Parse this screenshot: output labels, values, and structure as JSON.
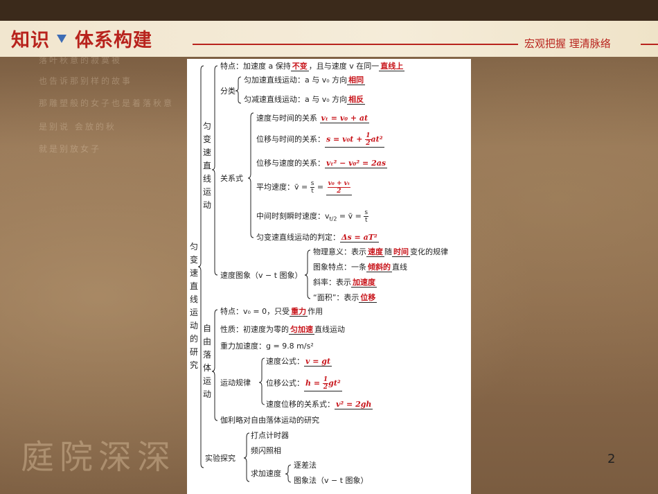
{
  "header": {
    "title_left": "知识",
    "title_right": "体系构建",
    "subtitle": "宏观把握  理清脉络"
  },
  "page_number": "2",
  "background_poem": [
    "落叶秋意的寂寞被",
    "也告诉那别样的故事",
    "那雕塑般的女子也是着落秋意",
    "是别说 会放的秋",
    "就是别放女子"
  ],
  "background_calligraphy": "庭院深深",
  "diagram": {
    "root": "匀变速直线运动的研究",
    "uam": {
      "label": "匀变速直线运动",
      "features": {
        "pre": "特点：加速度 a 保持",
        "ans1": "不变",
        "mid": "，且与速度 v 在同一",
        "ans2": "直线上"
      },
      "classification": {
        "label": "分类",
        "accel": {
          "pre": "匀加速直线运动：a 与 v₀ 方向",
          "ans": "相同"
        },
        "decel": {
          "pre": "匀减速直线运动：a 与 v₀ 方向",
          "ans": "相反"
        }
      },
      "relations": {
        "label": "关系式",
        "vt": {
          "pre": "速度与时间的关系",
          "ans": "vₜ = v₀ + at"
        },
        "xt": {
          "pre": "位移与时间的关系：",
          "ans_a": "s = v₀t + ",
          "ans_n": "1",
          "ans_d": "2",
          "ans_b": "at²"
        },
        "xv": {
          "pre": "位移与速度的关系：",
          "ans": "vₜ² − v₀² = 2as"
        },
        "avg": {
          "pre": "平均速度：v̄ = ",
          "s": "s",
          "t": "t",
          "eq": " = ",
          "ans_n": "v₀ + vₜ",
          "ans_d": "2"
        },
        "mid": {
          "pre": "中间时刻瞬时速度：v",
          "sub": "t/2",
          "eq": " = v̄ = ",
          "s": "s",
          "t": "t"
        },
        "judge": {
          "pre": "匀变速直线运动的判定：",
          "ans": "Δs = aT²"
        }
      },
      "vt_graph": {
        "label": "速度图象（v − t 图象）",
        "meaning": {
          "pre": "物理意义：表示",
          "ans1": "速度",
          "mid": "随",
          "ans2": "时间",
          "post": "变化的规律"
        },
        "feature": {
          "pre": "图象特点：一条",
          "ans": "倾斜的",
          "post": "直线"
        },
        "slope": {
          "pre": "斜率：表示",
          "ans": "加速度"
        },
        "area": {
          "pre": "“面积”：表示",
          "ans": "位移"
        }
      }
    },
    "freefall": {
      "label": "自由落体运动",
      "feature": {
        "pre": "特点：v₀ = 0，只受",
        "ans": "重力",
        "post": "作用"
      },
      "nature": {
        "pre": "性质：初速度为零的",
        "ans": "匀加速",
        "post": "直线运动"
      },
      "g": "重力加速度：g = 9.8 m/s²",
      "laws": {
        "label": "运动规律",
        "v": {
          "pre": "速度公式：",
          "ans": "v = gt"
        },
        "h": {
          "pre": "位移公式：",
          "ans_a": "h = ",
          "ans_n": "1",
          "ans_d": "2",
          "ans_b": "gt²"
        },
        "vh": {
          "pre": "速度位移的关系式：",
          "ans": "v² = 2gh"
        }
      },
      "galileo": "伽利略对自由落体运动的研究"
    },
    "experiment": {
      "label": "实验探究",
      "timer": "打点计时器",
      "flash": "频闪照相",
      "speed": {
        "label": "求加速度",
        "diff": "逐差法",
        "graph": "图象法（v − t 图象）"
      }
    }
  }
}
